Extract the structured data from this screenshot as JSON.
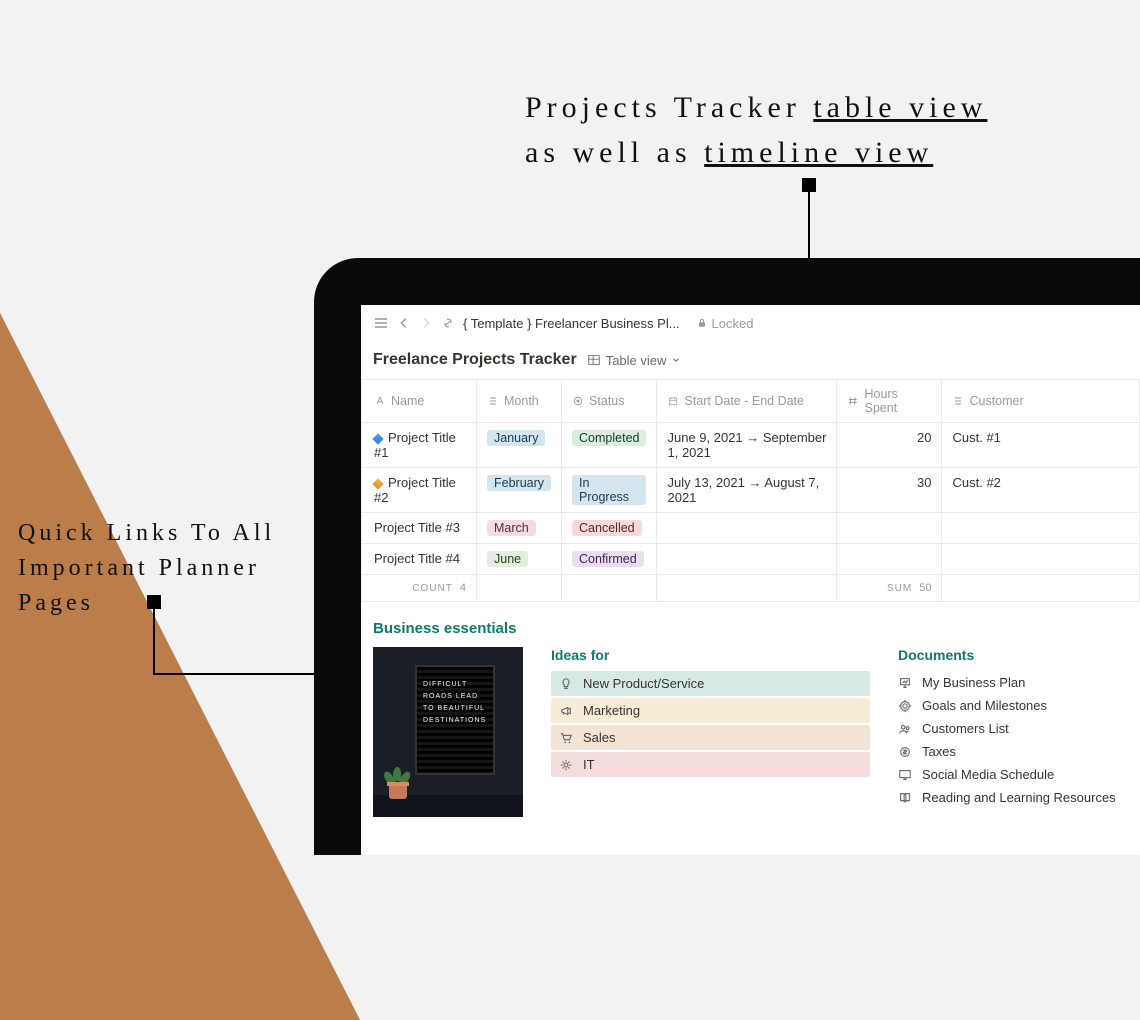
{
  "hero": {
    "line1_pre": "Projects Tracker ",
    "line1_u": "table view",
    "line2_pre": "as well as ",
    "line2_u": "timeline view"
  },
  "side_caption": "Quick Links To All Important Planner Pages",
  "topbar": {
    "breadcrumb": "{ Template } Freelancer Business Pl...",
    "locked": "Locked"
  },
  "database": {
    "title": "Freelance Projects Tracker",
    "view_label": "Table view",
    "columns": {
      "name": "Name",
      "month": "Month",
      "status": "Status",
      "date": "Start Date - End Date",
      "hours": "Hours Spent",
      "customer": "Customer"
    },
    "rows": [
      {
        "diamond": "blue",
        "name": "Project Title #1",
        "month": "January",
        "month_cls": "tag-blue",
        "status": "Completed",
        "status_cls": "tag-green",
        "date": "June 9, 2021 → September 1, 2021",
        "hours": "20",
        "customer": "Cust. #1"
      },
      {
        "diamond": "orange",
        "name": "Project Title #2",
        "month": "February",
        "month_cls": "tag-blue",
        "status": "In Progress",
        "status_cls": "tag-blue",
        "date": "July 13, 2021 → August 7, 2021",
        "hours": "30",
        "customer": "Cust. #2"
      },
      {
        "diamond": "",
        "name": "Project Title #3",
        "month": "March",
        "month_cls": "tag-pink",
        "status": "Cancelled",
        "status_cls": "tag-cancel",
        "date": "",
        "hours": "",
        "customer": ""
      },
      {
        "diamond": "",
        "name": "Project Title #4",
        "month": "June",
        "month_cls": "tag-lgreen",
        "status": "Confirmed",
        "status_cls": "tag-purple",
        "date": "",
        "hours": "",
        "customer": ""
      }
    ],
    "footer": {
      "count_label": "COUNT",
      "count_value": "4",
      "sum_label": "SUM",
      "sum_value": "50"
    }
  },
  "essentials": {
    "heading": "Business essentials",
    "letterboard": "DIFFICULT ROADS LEAD TO BEAUTIFUL DESTINATIONS",
    "ideas_title": "Ideas for",
    "ideas": [
      {
        "label": "New Product/Service",
        "cls": "i-teal",
        "icon": "bulb"
      },
      {
        "label": "Marketing",
        "cls": "i-yellow",
        "icon": "megaphone"
      },
      {
        "label": "Sales",
        "cls": "i-orange",
        "icon": "cart"
      },
      {
        "label": "IT",
        "cls": "i-red",
        "icon": "gear"
      }
    ],
    "docs_title": "Documents",
    "docs": [
      {
        "label": "My Business Plan",
        "icon": "presentation"
      },
      {
        "label": "Goals and Milestones",
        "icon": "target"
      },
      {
        "label": "Customers List",
        "icon": "people"
      },
      {
        "label": "Taxes",
        "icon": "coin"
      },
      {
        "label": "Social Media Schedule",
        "icon": "monitor"
      },
      {
        "label": "Reading and Learning Resources",
        "icon": "book"
      }
    ]
  }
}
